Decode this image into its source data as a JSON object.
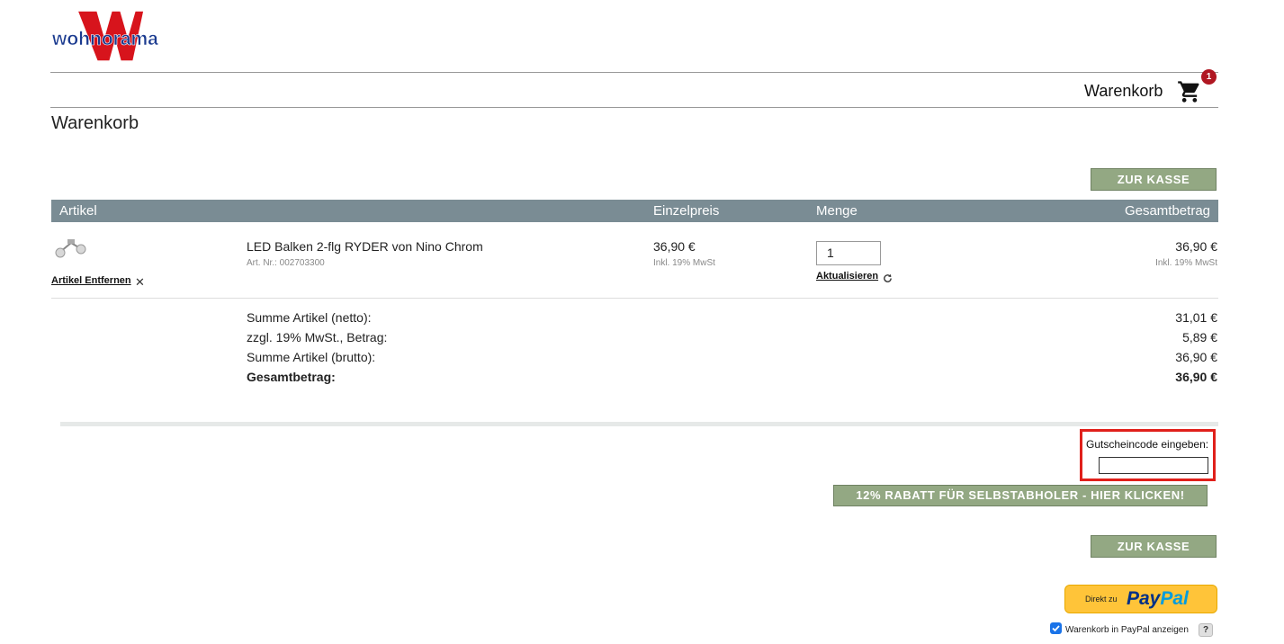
{
  "brand": {
    "logo_text": "wohnorama",
    "logo_letter": "W"
  },
  "header": {
    "cart_label": "Warenkorb",
    "cart_count": "1"
  },
  "page": {
    "title": "Warenkorb"
  },
  "buttons": {
    "checkout": "ZUR KASSE",
    "pickup_discount": "12% RABATT FÜR SELBSTABHOLER - HIER KLICKEN!"
  },
  "table": {
    "headers": [
      "Artikel",
      "Einzelpreis",
      "Menge",
      "Gesamtbetrag"
    ]
  },
  "item": {
    "name": "LED Balken 2-flg RYDER von Nino Chrom",
    "art_nr": "Art. Nr.: 002703300",
    "unit_price": "36,90 €",
    "tax_note": "Inkl. 19% MwSt",
    "quantity": "1",
    "update_label": "Aktualisieren",
    "total": "36,90 €",
    "remove_label": "Artikel Entfernen"
  },
  "summary": [
    {
      "label": "Summe Artikel (netto):",
      "value": "31,01 €",
      "bold": false
    },
    {
      "label": "zzgl. 19% MwSt., Betrag:",
      "value": "5,89 €",
      "bold": false
    },
    {
      "label": "Summe Artikel (brutto):",
      "value": "36,90 €",
      "bold": false
    },
    {
      "label": "Gesamtbetrag:",
      "value": "36,90 €",
      "bold": true
    }
  ],
  "coupon": {
    "label": "Gutscheincode eingeben:",
    "value": ""
  },
  "paypal": {
    "prefix": "Direkt zu",
    "brand_pay": "Pay",
    "brand_pal": "Pal",
    "show_cart_label": "Warenkorb in PayPal anzeigen",
    "help": "?"
  },
  "colors": {
    "brand_red": "#d7141c",
    "brand_blue": "#1a3a8f",
    "button_green": "#93a883",
    "table_header": "#7a8c94",
    "highlight": "#e0201b",
    "paypal_yellow": "#ffc439"
  }
}
